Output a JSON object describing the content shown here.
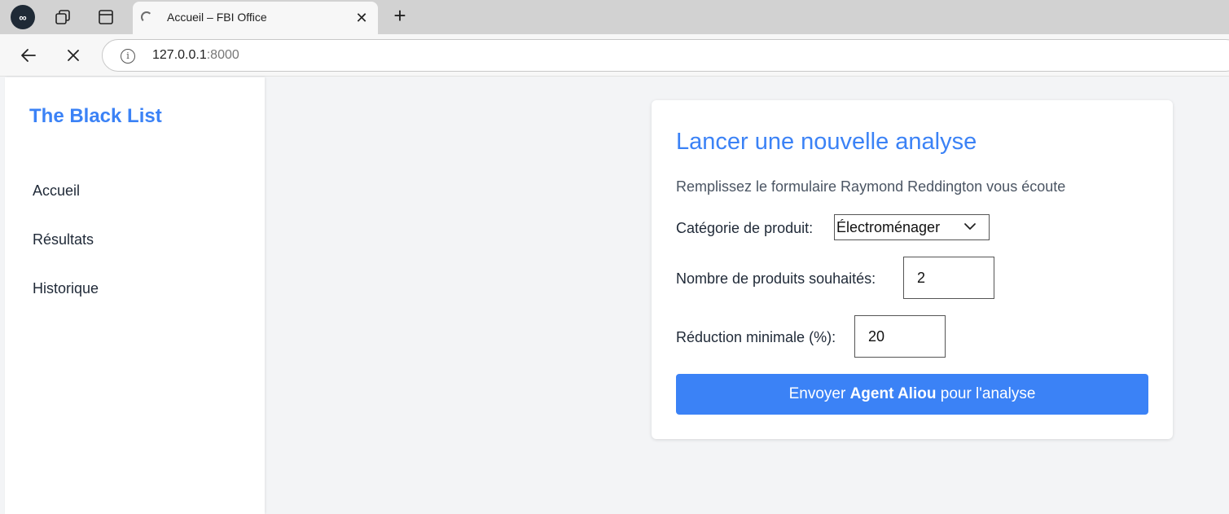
{
  "browser": {
    "profile_icon": "infinity-icon",
    "tab": {
      "title": "Accueil – FBI Office",
      "loading": true
    },
    "address": {
      "host": "127.0.0.1",
      "port": ":8000"
    }
  },
  "sidebar": {
    "brand": "The Black List",
    "items": [
      {
        "label": "Accueil"
      },
      {
        "label": "Résultats"
      },
      {
        "label": "Historique"
      }
    ]
  },
  "form": {
    "title": "Lancer une nouvelle analyse",
    "subtitle": "Remplissez le formulaire Raymond Reddington vous écoute",
    "category": {
      "label": "Catégorie de produit:",
      "value": "Électroménager"
    },
    "quantity": {
      "label": "Nombre de produits souhaités:",
      "value": "2"
    },
    "discount": {
      "label": "Réduction minimale (%):",
      "value": "20"
    },
    "submit": {
      "prefix": "Envoyer ",
      "bold": "Agent Aliou",
      "suffix": " pour l'analyse"
    }
  },
  "colors": {
    "accent": "#3b82f6",
    "page_bg": "#f3f4f6"
  }
}
